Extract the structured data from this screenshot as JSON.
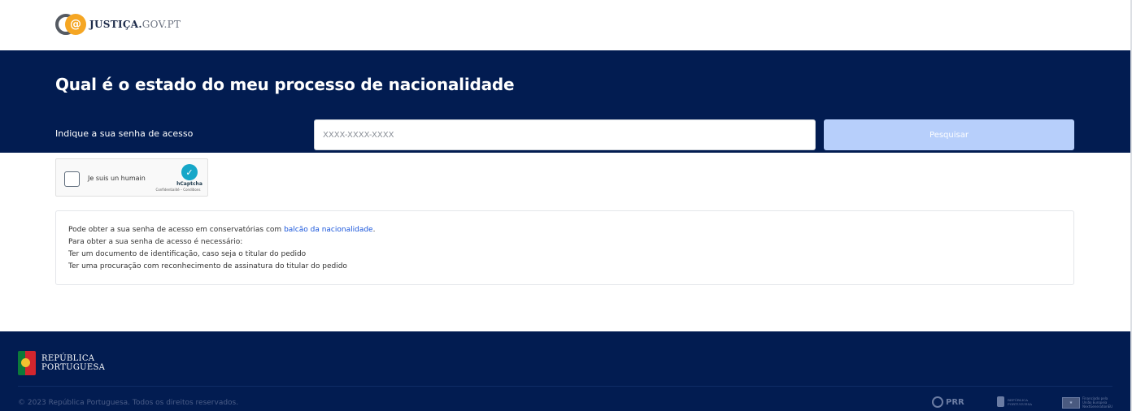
{
  "header": {
    "logo_name": "JUSTIÇA.",
    "logo_domain": "GOV.PT"
  },
  "hero": {
    "title": "Qual é o estado do meu processo de nacionalidade",
    "field_label": "Indique a sua senha de acesso",
    "input_placeholder": "XXXX-XXXX-XXXX",
    "input_value": "",
    "search_label": "Pesquisar"
  },
  "captcha": {
    "label": "Je suis un humain",
    "brand": "hCaptcha",
    "links": "Confidentialité – Conditions"
  },
  "info": {
    "line1_prefix": "Pode obter a sua senha de acesso em conservatórias com ",
    "line1_link": "balcão da nacionalidade",
    "line1_suffix": ".",
    "line2": "Para obter a sua senha de acesso é necessário:",
    "line3": "Ter um documento de identificação, caso seja o titular do pedido",
    "line4": "Ter uma procuração com reconhecimento de assinatura do titular do pedido"
  },
  "footer": {
    "republic_line1": "REPÚBLICA",
    "republic_line2": "PORTUGUESA",
    "copyright": "© 2023 República Portuguesa. Todos os direitos reservados.",
    "partners": {
      "prr": "PRR",
      "rp_line1": "REPÚBLICA",
      "rp_line2": "PORTUGUESA",
      "eu_line1": "Financiado pela",
      "eu_line2": "União Europeia",
      "eu_line3": "NextGenerationEU"
    }
  },
  "colors": {
    "navy": "#021c51",
    "button_disabled": "#b7cffb",
    "link": "#1a56db",
    "logo_gold": "#f5a623"
  }
}
